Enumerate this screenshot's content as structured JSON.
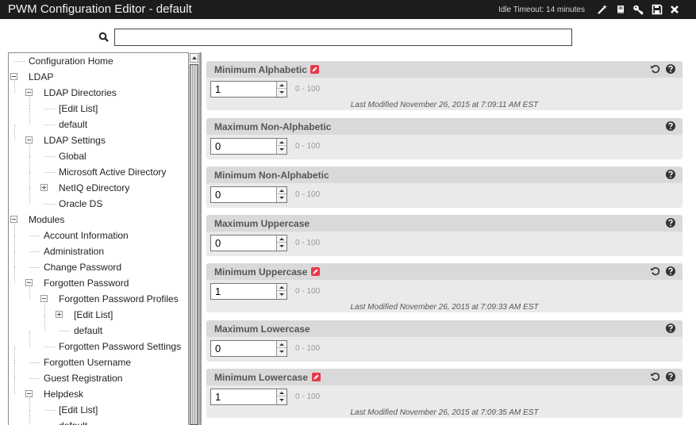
{
  "window": {
    "title": "PWM Configuration Editor - default",
    "idle_timeout": "Idle Timeout: 14 minutes",
    "icons": [
      "magic-wand-icon",
      "book-icon",
      "key-icon",
      "save-icon",
      "close-icon"
    ]
  },
  "search": {
    "value": "",
    "placeholder": ""
  },
  "tree": [
    {
      "label": "Configuration Home"
    },
    {
      "label": "LDAP"
    },
    {
      "label": "LDAP Directories"
    },
    {
      "label": "[Edit List]"
    },
    {
      "label": "default"
    },
    {
      "label": "LDAP Settings"
    },
    {
      "label": "Global"
    },
    {
      "label": "Microsoft Active Directory"
    },
    {
      "label": "NetIQ eDirectory"
    },
    {
      "label": "Oracle DS"
    },
    {
      "label": "Modules"
    },
    {
      "label": "Account Information"
    },
    {
      "label": "Administration"
    },
    {
      "label": "Change Password"
    },
    {
      "label": "Forgotten Password"
    },
    {
      "label": "Forgotten Password Profiles"
    },
    {
      "label": "[Edit List]"
    },
    {
      "label": "default"
    },
    {
      "label": "Forgotten Password Settings"
    },
    {
      "label": "Forgotten Username"
    },
    {
      "label": "Guest Registration"
    },
    {
      "label": "Helpdesk"
    },
    {
      "label": "[Edit List]"
    },
    {
      "label": "default"
    }
  ],
  "settings": [
    {
      "name": "Minimum Alphabetic",
      "modified": true,
      "value": "1",
      "range": "0 - 100",
      "last_modified": "Last Modified November 26, 2015 at 7:09:11 AM EST"
    },
    {
      "name": "Maximum Non-Alphabetic",
      "modified": false,
      "value": "0",
      "range": "0 - 100",
      "last_modified": ""
    },
    {
      "name": "Minimum Non-Alphabetic",
      "modified": false,
      "value": "0",
      "range": "0 - 100",
      "last_modified": ""
    },
    {
      "name": "Maximum Uppercase",
      "modified": false,
      "value": "0",
      "range": "0 - 100",
      "last_modified": ""
    },
    {
      "name": "Minimum Uppercase",
      "modified": true,
      "value": "1",
      "range": "0 - 100",
      "last_modified": "Last Modified November 26, 2015 at 7:09:33 AM EST"
    },
    {
      "name": "Maximum Lowercase",
      "modified": false,
      "value": "0",
      "range": "0 - 100",
      "last_modified": ""
    },
    {
      "name": "Minimum Lowercase",
      "modified": true,
      "value": "1",
      "range": "0 - 100",
      "last_modified": "Last Modified November 26, 2015 at 7:09:35 AM EST"
    }
  ],
  "colors": {
    "header_bg": "#1c1c1c",
    "modified_badge": "#e8394b",
    "setting_header": "#d9d9d9",
    "setting_body": "#eaeaea"
  }
}
